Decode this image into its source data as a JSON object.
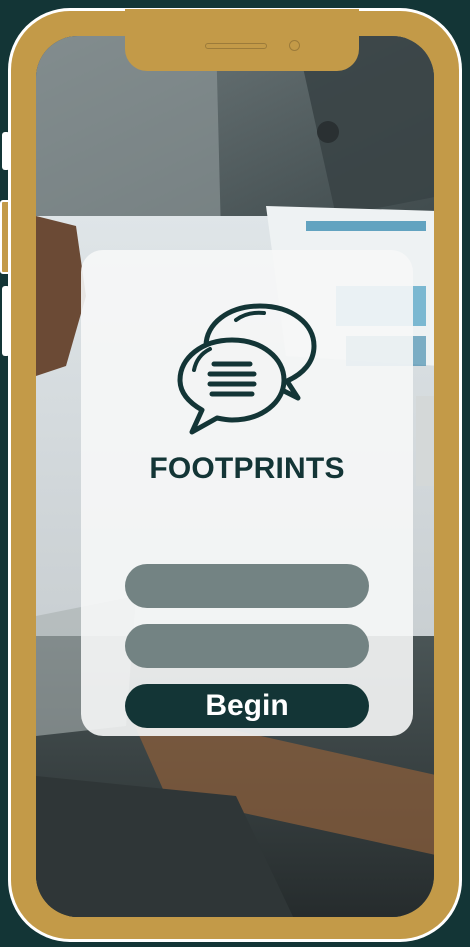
{
  "app": {
    "brand": "FOOTPRINTS"
  },
  "login": {
    "field1_placeholder": "",
    "field1_value": "",
    "field2_placeholder": "",
    "field2_value": "",
    "begin_label": "Begin"
  },
  "icons": {
    "logo": "chat-bubbles-icon"
  },
  "colors": {
    "background": "#133536",
    "bezel": "#c39a48",
    "card": "#f6f7f7",
    "field": "#738383",
    "button": "#133536",
    "brand_text": "#133536"
  }
}
